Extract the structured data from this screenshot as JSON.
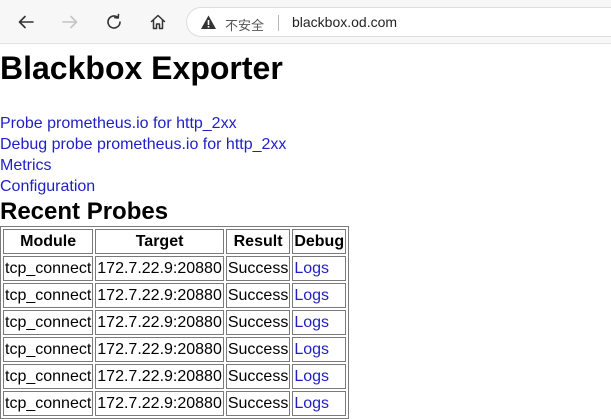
{
  "browser": {
    "security_label": "不安全",
    "url": "blackbox.od.com"
  },
  "page": {
    "title": "Blackbox Exporter",
    "links": [
      "Probe prometheus.io for http_2xx",
      "Debug probe prometheus.io for http_2xx",
      "Metrics",
      "Configuration"
    ],
    "recent_title": "Recent Probes",
    "table": {
      "headers": [
        "Module",
        "Target",
        "Result",
        "Debug"
      ],
      "rows": [
        [
          "tcp_connect",
          "172.7.22.9:20880",
          "Success",
          "Logs"
        ],
        [
          "tcp_connect",
          "172.7.22.9:20880",
          "Success",
          "Logs"
        ],
        [
          "tcp_connect",
          "172.7.22.9:20880",
          "Success",
          "Logs"
        ],
        [
          "tcp_connect",
          "172.7.22.9:20880",
          "Success",
          "Logs"
        ],
        [
          "tcp_connect",
          "172.7.22.9:20880",
          "Success",
          "Logs"
        ],
        [
          "tcp_connect",
          "172.7.22.9:20880",
          "Success",
          "Logs"
        ]
      ]
    }
  },
  "colors": {
    "link": "#1f1fc4",
    "toolbar_bg": "#f7f7f7"
  }
}
